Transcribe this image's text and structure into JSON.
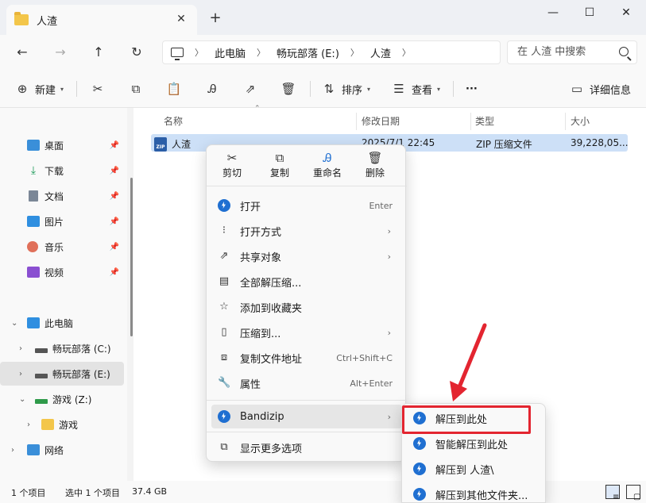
{
  "window": {
    "tab_title": "人渣",
    "tab_close": "✕",
    "tab_add": "+",
    "minimize": "—",
    "maximize": "☐",
    "close": "✕"
  },
  "nav": {
    "breadcrumbs": [
      "此电脑",
      "畅玩部落 (E:)",
      "人渣"
    ],
    "search_placeholder": "在 人渣 中搜索"
  },
  "toolbar": {
    "new_label": "新建",
    "sort_label": "排序",
    "view_label": "查看",
    "more_label": "···",
    "details_label": "详细信息"
  },
  "sidebar": {
    "quick": [
      "桌面",
      "下载",
      "文档",
      "图片",
      "音乐",
      "视频"
    ],
    "this_pc": "此电脑",
    "drive_c": "畅玩部落 (C:)",
    "drive_e": "畅玩部落 (E:)",
    "drive_z": "游戏 (Z:)",
    "folder_game": "游戏",
    "network": "网络"
  },
  "columns": {
    "name": "名称",
    "modified": "修改日期",
    "type": "类型",
    "size": "大小"
  },
  "file": {
    "name": "人渣",
    "modified": "2025/7/1 22:45",
    "type": "ZIP 压缩文件",
    "size": "39,228,05..."
  },
  "status": {
    "count": "1 个项目",
    "selected": "选中 1 个项目",
    "selected_size": "37.4 GB"
  },
  "context_menu": {
    "quick_actions": [
      "剪切",
      "复制",
      "重命名",
      "删除"
    ],
    "items": [
      {
        "label": "打开",
        "accel": "Enter"
      },
      {
        "label": "打开方式",
        "accel": ""
      },
      {
        "label": "共享对象",
        "accel": ""
      },
      {
        "label": "全部解压缩...",
        "accel": ""
      },
      {
        "label": "添加到收藏夹",
        "accel": ""
      },
      {
        "label": "压缩到...",
        "accel": ""
      },
      {
        "label": "复制文件地址",
        "accel": "Ctrl+Shift+C"
      },
      {
        "label": "属性",
        "accel": "Alt+Enter"
      }
    ],
    "bandizip": "Bandizip",
    "more_options": "显示更多选项"
  },
  "submenu": {
    "items": [
      "解压到此处",
      "智能解压到此处",
      "解压到 人渣\\",
      "解压到其他文件夹..."
    ]
  },
  "colors": {
    "accent": "#1f6fd1",
    "selection": "#cde0f7",
    "annotation": "#e32530"
  }
}
